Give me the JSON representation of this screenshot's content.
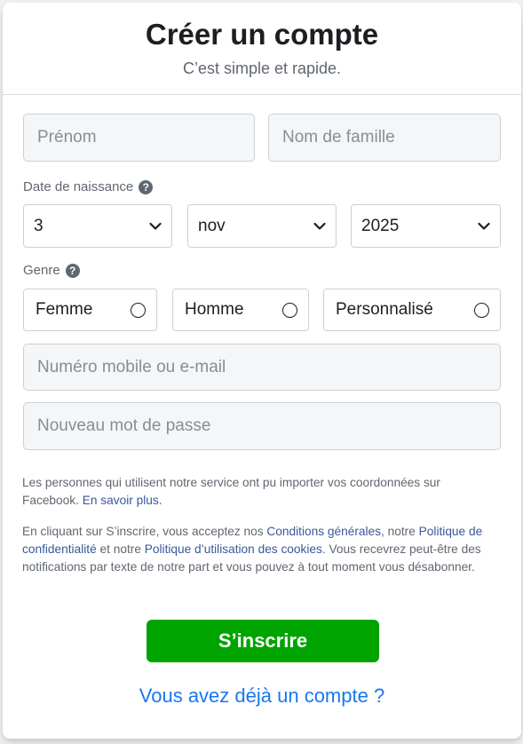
{
  "header": {
    "title": "Créer un compte",
    "subtitle": "C’est simple et rapide."
  },
  "fields": {
    "first_name_placeholder": "Prénom",
    "last_name_placeholder": "Nom de famille",
    "contact_placeholder": "Numéro mobile ou e-mail",
    "password_placeholder": "Nouveau mot de passe"
  },
  "birthday": {
    "label": "Date de naissance",
    "day": "3",
    "month": "nov",
    "year": "2025"
  },
  "gender": {
    "label": "Genre",
    "options": [
      {
        "label": "Femme",
        "selected": false
      },
      {
        "label": "Homme",
        "selected": false
      },
      {
        "label": "Personnalisé",
        "selected": false
      }
    ]
  },
  "legal": {
    "contacts_text": "Les personnes qui utilisent notre service ont pu importer vos coordonnées sur Facebook.",
    "learn_more": "En savoir plus",
    "contacts_end": ".",
    "terms_intro": "En cliquant sur S’inscrire, vous acceptez nos",
    "terms_link": "Conditions générales",
    "terms_mid": ", notre",
    "privacy_link": "Politique de confidentialité",
    "and_text": "et notre",
    "cookies_link": "Politique d’utilisation des cookies",
    "terms_end": ". Vous recevrez peut-être des notifications par texte de notre part et vous pouvez à tout moment vous désabonner."
  },
  "actions": {
    "signup_label": "S’inscrire",
    "login_link": "Vous avez déjà un compte ?"
  },
  "colors": {
    "signup_green": "#00a400",
    "link_blue": "#1877f2",
    "legal_link": "#385898"
  }
}
